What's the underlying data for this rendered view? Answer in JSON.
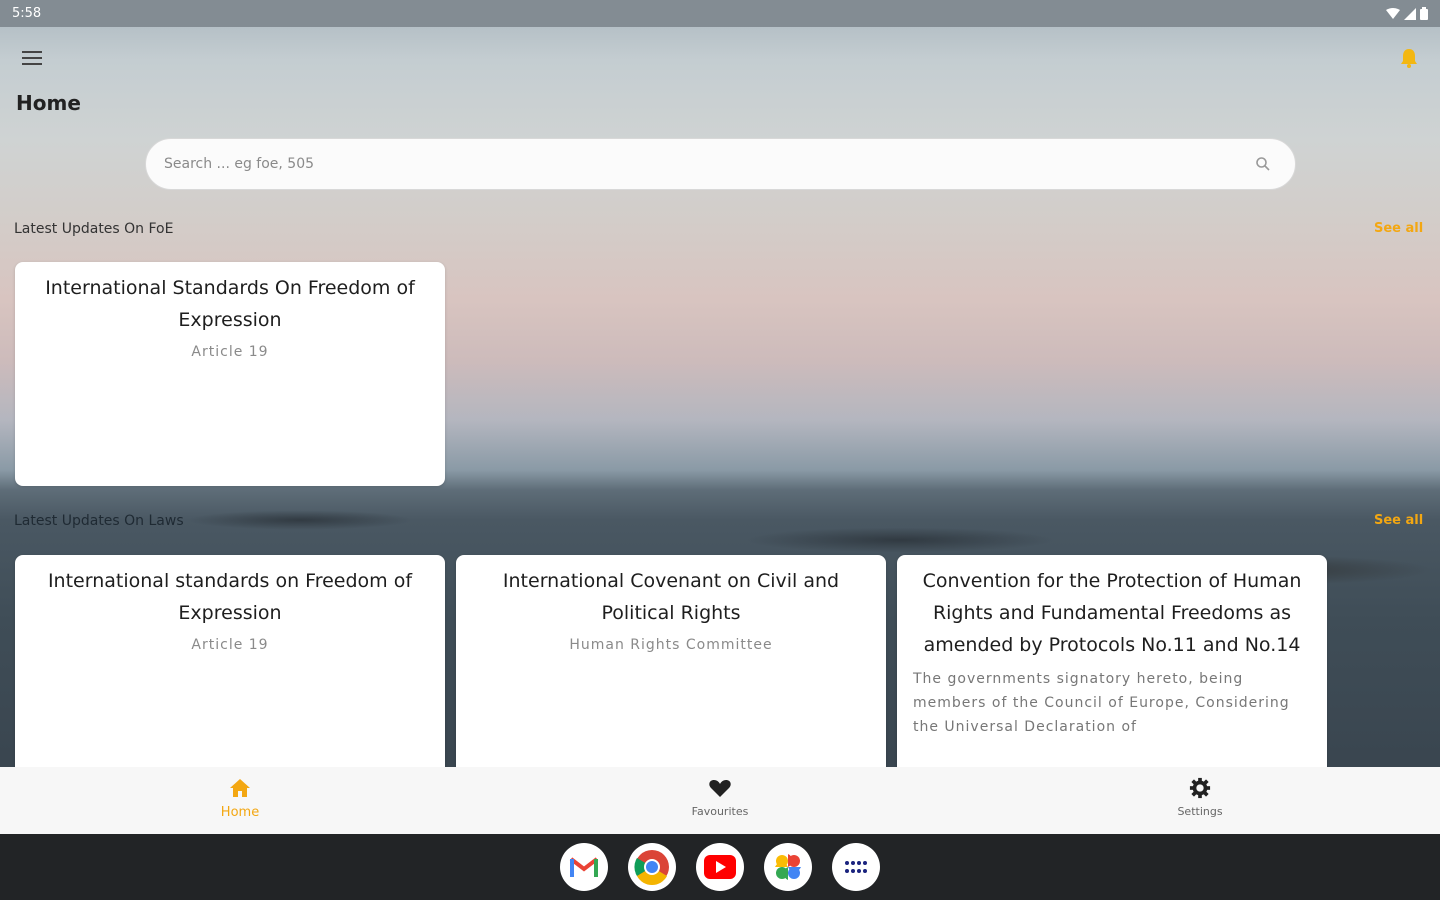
{
  "status_bar": {
    "time": "5:58"
  },
  "header": {
    "title": "Home"
  },
  "search": {
    "placeholder": "Search ... eg foe, 505"
  },
  "sections": [
    {
      "label": "Latest Updates On FoE",
      "see_all": "See all",
      "cards": [
        {
          "title": "International Standards On Freedom of Expression",
          "subtitle": "Article 19"
        }
      ]
    },
    {
      "label": "Latest Updates On Laws",
      "see_all": "See all",
      "cards": [
        {
          "title": "International standards on Freedom of Expression",
          "subtitle": "Article 19"
        },
        {
          "title": "International Covenant on Civil and Political Rights",
          "subtitle": "Human Rights Committee"
        },
        {
          "title": "Convention for the Protection of Human Rights and Fundamental Freedoms as amended by Protocols No.11 and No.14",
          "body": "The governments signatory hereto, being members of the Council of Europe, Considering the Universal Declaration of"
        }
      ]
    }
  ],
  "bottom_nav": [
    {
      "label": "Home",
      "icon": "home-icon",
      "active": true
    },
    {
      "label": "Favourites",
      "icon": "heart-icon",
      "active": false
    },
    {
      "label": "Settings",
      "icon": "gear-icon",
      "active": false
    }
  ],
  "dock": [
    {
      "icon": "gmail-icon"
    },
    {
      "icon": "chrome-icon"
    },
    {
      "icon": "youtube-icon"
    },
    {
      "icon": "photos-icon"
    },
    {
      "icon": "app-drawer-icon"
    }
  ],
  "colors": {
    "accent": "#f3a712",
    "nav_bg": "#f7f7f7",
    "status_bar": "#838c93"
  }
}
